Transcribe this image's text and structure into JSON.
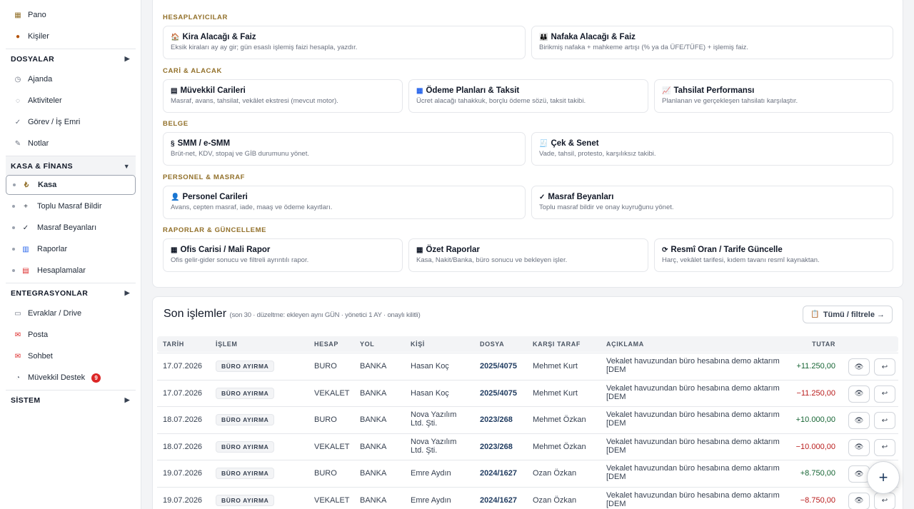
{
  "sidebar": {
    "pano": "Pano",
    "kisiler": "Kişiler",
    "dosyalar": "DOSYALAR",
    "ajanda": "Ajanda",
    "aktiviteler": "Aktiviteler",
    "gorev": "Görev / İş Emri",
    "notlar": "Notlar",
    "kasa_finans": "KASA & FİNANS",
    "kasa": "Kasa",
    "toplu_masraf": "Toplu Masraf Bildir",
    "masraf_beyanlari": "Masraf Beyanları",
    "raporlar": "Raporlar",
    "hesaplamalar": "Hesaplamalar",
    "entegrasyonlar": "ENTEGRASYONLAR",
    "evraklar": "Evraklar / Drive",
    "posta": "Posta",
    "sohbet": "Sohbet",
    "muvekkil_destek": "Müvekkil Destek",
    "muvekkil_badge": "9",
    "sistem": "SİSTEM"
  },
  "groups": {
    "hesaplayicilar": "HESAPLAYICILAR",
    "cari": "CARİ & ALACAK",
    "belge": "BELGE",
    "personel": "PERSONEL & MASRAF",
    "raporlar": "RAPORLAR & GÜNCELLEME"
  },
  "tiles": {
    "kira": {
      "title": "Kira Alacağı & Faiz",
      "desc": "Eksik kiraları ay ay gir; gün esaslı işlemiş faizi hesapla, yazdır."
    },
    "nafaka": {
      "title": "Nafaka Alacağı & Faiz",
      "desc": "Birikmiş nafaka + mahkeme artışı (% ya da ÜFE/TÜFE) + işlemiş faiz."
    },
    "muvekkil_cari": {
      "title": "Müvekkil Carileri",
      "desc": "Masraf, avans, tahsilat, vekâlet ekstresi (mevcut motor)."
    },
    "odeme": {
      "title": "Ödeme Planları & Taksit",
      "desc": "Ücret alacağı tahakkuk, borçlu ödeme sözü, taksit takibi."
    },
    "tahsilat": {
      "title": "Tahsilat Performansı",
      "desc": "Planlanan ve gerçekleşen tahsilatı karşılaştır."
    },
    "smm": {
      "title": "SMM / e-SMM",
      "desc": "Brüt-net, KDV, stopaj ve GİB durumunu yönet."
    },
    "cek": {
      "title": "Çek & Senet",
      "desc": "Vade, tahsil, protesto, karşılıksız takibi."
    },
    "personel_cari": {
      "title": "Personel Carileri",
      "desc": "Avans, cepten masraf, iade, maaş ve ödeme kayıtları."
    },
    "masraf_bey": {
      "title": "Masraf Beyanları",
      "desc": "Toplu masraf bildir ve onay kuyruğunu yönet."
    },
    "ofis_cari": {
      "title": "Ofis Carisi / Mali Rapor",
      "desc": "Ofis gelir-gider sonucu ve filtreli ayrıntılı rapor."
    },
    "ozet": {
      "title": "Özet Raporlar",
      "desc": "Kasa, Nakit/Banka, büro sonucu ve bekleyen işler."
    },
    "resmi_oran": {
      "title": "Resmî Oran / Tarife Güncelle",
      "desc": "Harç, vekâlet tarifesi, kıdem tavanı resmî kaynaktan."
    }
  },
  "recent": {
    "title": "Son işlemler",
    "subtitle": "(son 30 · düzeltme: ekleyen aynı GÜN · yönetici 1 AY · onaylı kilitli)",
    "all_button": "Tümü / filtrele →",
    "headers": {
      "tarih": "TARİH",
      "islem": "İŞLEM",
      "hesap": "HESAP",
      "yol": "YOL",
      "kisi": "KİŞİ",
      "dosya": "DOSYA",
      "karsi": "KARŞI TARAF",
      "aciklama": "AÇIKLAMA",
      "tutar": "TUTAR"
    },
    "rows": [
      {
        "tarih": "17.07.2026",
        "islem": "BÜRO AYIRMA",
        "hesap": "BURO",
        "yol": "BANKA",
        "kisi1": "Hasan Koç",
        "kisi2": "",
        "dosya": "2025/4075",
        "karsi": "Mehmet Kurt",
        "ac1": "Vekalet havuzundan büro hesabına demo aktarım",
        "ac2": "[DEM",
        "tutar": "+11.250,00",
        "sign": "pos"
      },
      {
        "tarih": "17.07.2026",
        "islem": "BÜRO AYIRMA",
        "hesap": "VEKALET",
        "yol": "BANKA",
        "kisi1": "Hasan Koç",
        "kisi2": "",
        "dosya": "2025/4075",
        "karsi": "Mehmet Kurt",
        "ac1": "Vekalet havuzundan büro hesabına demo aktarım",
        "ac2": "[DEM",
        "tutar": "−11.250,00",
        "sign": "neg"
      },
      {
        "tarih": "18.07.2026",
        "islem": "BÜRO AYIRMA",
        "hesap": "BURO",
        "yol": "BANKA",
        "kisi1": "Nova Yazılım",
        "kisi2": "Ltd. Şti.",
        "dosya": "2023/268",
        "karsi": "Mehmet Özkan",
        "ac1": "Vekalet havuzundan büro hesabına demo aktarım",
        "ac2": "[DEM",
        "tutar": "+10.000,00",
        "sign": "pos"
      },
      {
        "tarih": "18.07.2026",
        "islem": "BÜRO AYIRMA",
        "hesap": "VEKALET",
        "yol": "BANKA",
        "kisi1": "Nova Yazılım",
        "kisi2": "Ltd. Şti.",
        "dosya": "2023/268",
        "karsi": "Mehmet Özkan",
        "ac1": "Vekalet havuzundan büro hesabına demo aktarım",
        "ac2": "[DEM",
        "tutar": "−10.000,00",
        "sign": "neg"
      },
      {
        "tarih": "19.07.2026",
        "islem": "BÜRO AYIRMA",
        "hesap": "BURO",
        "yol": "BANKA",
        "kisi1": "Emre Aydın",
        "kisi2": "",
        "dosya": "2024/1627",
        "karsi": "Ozan Özkan",
        "ac1": "Vekalet havuzundan büro hesabına demo aktarım",
        "ac2": "[DEM",
        "tutar": "+8.750,00",
        "sign": "pos"
      },
      {
        "tarih": "19.07.2026",
        "islem": "BÜRO AYIRMA",
        "hesap": "VEKALET",
        "yol": "BANKA",
        "kisi1": "Emre Aydın",
        "kisi2": "",
        "dosya": "2024/1627",
        "karsi": "Ozan Özkan",
        "ac1": "Vekalet havuzundan büro hesabına demo aktarım",
        "ac2": "[DEM",
        "tutar": "−8.750,00",
        "sign": "neg"
      }
    ]
  },
  "colors": {
    "accent": "#92702a",
    "positive": "#166534",
    "negative": "#b91c1c",
    "link": "#1e3a5f"
  },
  "icons": {
    "view": "eye-icon",
    "revert": "undo-icon",
    "fab": "plus-icon"
  }
}
